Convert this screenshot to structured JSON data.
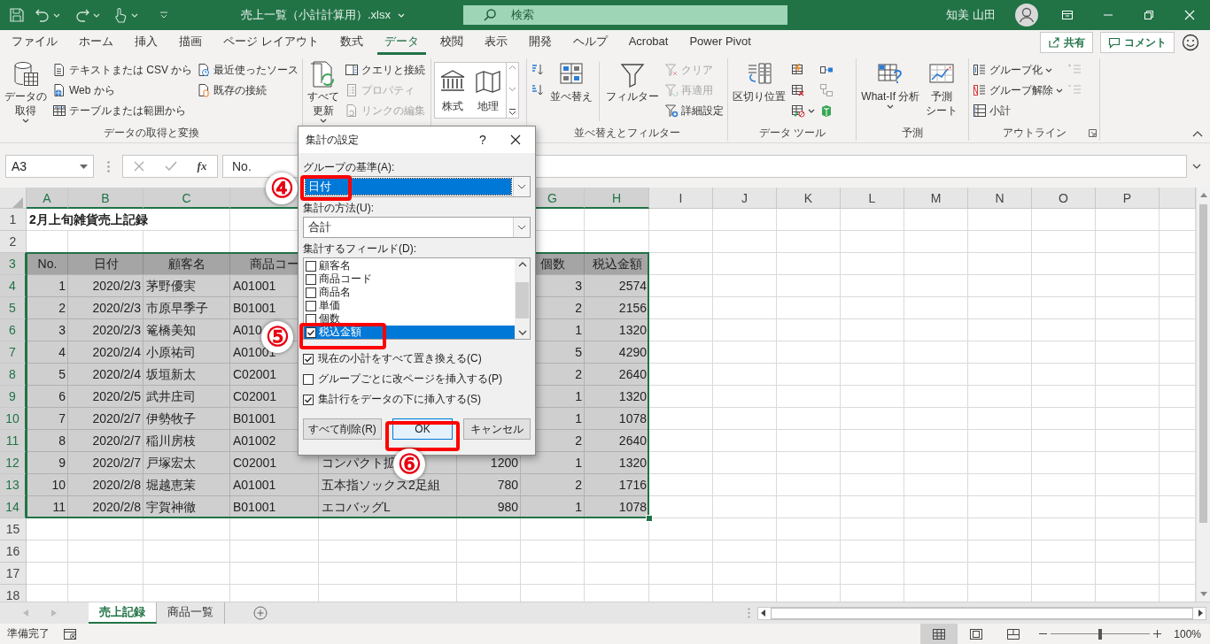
{
  "title_bar": {
    "file_name": "売上一覧（小計計算用）.xlsx",
    "search_placeholder": "検索",
    "user_name": "知美 山田"
  },
  "ribbon_tabs": [
    {
      "label": "ファイル",
      "selected": false
    },
    {
      "label": "ホーム",
      "selected": false
    },
    {
      "label": "挿入",
      "selected": false
    },
    {
      "label": "描画",
      "selected": false
    },
    {
      "label": "ページ レイアウト",
      "selected": false
    },
    {
      "label": "数式",
      "selected": false
    },
    {
      "label": "データ",
      "selected": true
    },
    {
      "label": "校閲",
      "selected": false
    },
    {
      "label": "表示",
      "selected": false
    },
    {
      "label": "開発",
      "selected": false
    },
    {
      "label": "ヘルプ",
      "selected": false
    },
    {
      "label": "Acrobat",
      "selected": false
    },
    {
      "label": "Power Pivot",
      "selected": false
    }
  ],
  "share_button": "共有",
  "comment_button": "コメント",
  "ribbon_groups": [
    {
      "label": "データの取得と変換",
      "launcher": false,
      "columns": [
        {
          "kind": "large",
          "label_lines": [
            "データの",
            "取得"
          ],
          "has_menu": true
        },
        {
          "kind": "stack",
          "items": [
            {
              "label": "テキストまたは CSV から",
              "disabled": false,
              "has_menu": false
            },
            {
              "label": "Web から",
              "disabled": false,
              "has_menu": false
            },
            {
              "label": "テーブルまたは範囲から",
              "disabled": false,
              "has_menu": false
            }
          ]
        },
        {
          "kind": "stack",
          "items": [
            {
              "label": "最近使ったソース",
              "disabled": false,
              "has_menu": false
            },
            {
              "label": "既存の接続",
              "disabled": false,
              "has_menu": false
            }
          ]
        }
      ]
    },
    {
      "columns": [
        {
          "kind": "large",
          "label_lines": [
            "すべて",
            "更新"
          ],
          "has_menu": true
        },
        {
          "kind": "stack",
          "items": [
            {
              "label": "クエリと接続",
              "disabled": false,
              "has_menu": false
            },
            {
              "label": "プロパティ",
              "disabled": true,
              "has_menu": false
            },
            {
              "label": "リンクの編集",
              "disabled": true,
              "has_menu": false
            }
          ]
        }
      ]
    },
    {
      "columns": [
        {
          "kind": "gallery",
          "items": [
            {
              "label": "株式"
            },
            {
              "label": "地理"
            }
          ]
        }
      ]
    },
    {
      "label": "並べ替えとフィルター",
      "launcher": false,
      "columns": [
        {
          "kind": "stack",
          "items": [
            {
              "disabled": false,
              "has_menu": false
            },
            {
              "disabled": false,
              "has_menu": false
            }
          ]
        },
        {
          "kind": "large",
          "label_lines": [
            "並べ替え"
          ],
          "has_menu": false
        },
        {
          "kind": "large",
          "label_lines": [
            "フィルター"
          ],
          "has_menu": false
        },
        {
          "kind": "stack",
          "items": [
            {
              "label": "クリア",
              "disabled": true,
              "has_menu": false
            },
            {
              "label": "再適用",
              "disabled": true,
              "has_menu": false
            },
            {
              "label": "詳細設定",
              "disabled": false,
              "has_menu": false
            }
          ]
        }
      ]
    },
    {
      "label": "データ ツール",
      "launcher": false,
      "columns": [
        {
          "kind": "large",
          "label_lines": [
            "区切り位置"
          ],
          "has_menu": false
        },
        {
          "kind": "stack",
          "items": [
            {
              "disabled": false,
              "has_menu": false
            },
            {
              "disabled": false,
              "has_menu": false
            },
            {
              "disabled": false,
              "has_menu": true
            }
          ]
        },
        {
          "kind": "stack",
          "items": [
            {
              "disabled": false,
              "has_menu": false
            },
            {
              "disabled": true,
              "has_menu": false
            },
            {
              "disabled": false,
              "has_menu": false
            }
          ]
        }
      ]
    },
    {
      "label": "予測",
      "launcher": false,
      "columns": [
        {
          "kind": "large",
          "label_lines": [
            "What-If 分析"
          ],
          "has_menu": true
        },
        {
          "kind": "large",
          "label_lines": [
            "予測",
            "シート"
          ],
          "has_menu": false
        }
      ]
    },
    {
      "label": "アウトライン",
      "launcher": true,
      "columns": [
        {
          "kind": "stack",
          "items": [
            {
              "label": "グループ化",
              "disabled": false,
              "has_menu": true
            },
            {
              "label": "グループ解除",
              "disabled": false,
              "has_menu": true
            },
            {
              "label": "小計",
              "disabled": false,
              "has_menu": false
            }
          ]
        },
        {
          "kind": "stack",
          "items": [
            {
              "disabled": true,
              "has_menu": false
            },
            {
              "disabled": true,
              "has_menu": false
            }
          ]
        }
      ]
    }
  ],
  "formula_bar": {
    "name_box": "A3",
    "function_button": "fx",
    "formula": "No."
  },
  "sheet": {
    "columns": [
      {
        "label": "A",
        "selected": true
      },
      {
        "label": "B",
        "selected": true
      },
      {
        "label": "C",
        "selected": true
      },
      {
        "selected": true
      },
      null,
      null,
      {
        "label": "G",
        "selected": true
      },
      {
        "label": "H",
        "selected": true
      },
      {
        "label": "I",
        "selected": false
      },
      {
        "label": "J",
        "selected": false
      },
      {
        "label": "K",
        "selected": false
      },
      {
        "label": "L",
        "selected": false
      },
      {
        "label": "M",
        "selected": false
      },
      {
        "label": "N",
        "selected": false
      },
      {
        "label": "O",
        "selected": false
      },
      {
        "label": "P",
        "selected": false
      }
    ],
    "rows": [
      {
        "number": "1",
        "kind": "title",
        "selected": false,
        "cells": [
          "2月上旬雑貨売上記録"
        ]
      },
      {
        "number": "2",
        "kind": "blank",
        "selected": false
      },
      {
        "number": "3",
        "kind": "header",
        "selected": true,
        "cells": [
          "No.",
          "日付",
          "顧客名",
          "商品コー",
          null,
          null,
          "個数",
          "税込金額"
        ]
      },
      {
        "number": "4",
        "kind": "data",
        "selected": true,
        "cells": [
          "1",
          "2020/2/3",
          "茅野優実",
          "A01001",
          null,
          null,
          "3",
          "2574"
        ]
      },
      {
        "number": "5",
        "kind": "data",
        "selected": true,
        "cells": [
          "2",
          "2020/2/3",
          "市原早季子",
          "B01001",
          null,
          null,
          "2",
          "2156"
        ]
      },
      {
        "number": "6",
        "kind": "data",
        "selected": true,
        "cells": [
          "3",
          "2020/2/3",
          "篭橋美知",
          "A010",
          null,
          null,
          "1",
          "1320"
        ]
      },
      {
        "number": "7",
        "kind": "data",
        "selected": true,
        "cells": [
          "4",
          "2020/2/4",
          "小原祐司",
          "A01001",
          null,
          null,
          "5",
          "4290"
        ]
      },
      {
        "number": "8",
        "kind": "data",
        "selected": true,
        "cells": [
          "5",
          "2020/2/4",
          "坂垣新太",
          "C02001",
          null,
          null,
          "2",
          "2640"
        ]
      },
      {
        "number": "9",
        "kind": "data",
        "selected": true,
        "cells": [
          "6",
          "2020/2/5",
          "武井庄司",
          "C02001",
          null,
          null,
          "1",
          "1320"
        ]
      },
      {
        "number": "10",
        "kind": "data",
        "selected": true,
        "cells": [
          "7",
          "2020/2/7",
          "伊勢牧子",
          "B01001",
          null,
          null,
          "1",
          "1078"
        ]
      },
      {
        "number": "11",
        "kind": "data",
        "selected": true,
        "cells": [
          "8",
          "2020/2/7",
          "稲川房枝",
          "A01002",
          null,
          null,
          "2",
          "2640"
        ]
      },
      {
        "number": "12",
        "kind": "data",
        "selected": true,
        "cells": [
          "9",
          "2020/2/7",
          "戸塚宏太",
          "C02001",
          "コンパクト拡",
          "1200",
          "1",
          "1320"
        ]
      },
      {
        "number": "13",
        "kind": "data",
        "selected": true,
        "cells": [
          "10",
          "2020/2/8",
          "堀越恵茉",
          "A01001",
          "五本指ソックス2足組",
          "780",
          "2",
          "1716"
        ]
      },
      {
        "number": "14",
        "kind": "data",
        "selected": true,
        "cells": [
          "11",
          "2020/2/8",
          "宇賀神徹",
          "B01001",
          "エコバッグL",
          "980",
          "1",
          "1078"
        ]
      },
      {
        "number": "15",
        "kind": "blank",
        "selected": false
      },
      {
        "number": "16",
        "kind": "blank",
        "selected": false
      },
      {
        "number": "17",
        "kind": "blank",
        "selected": false
      },
      {
        "number": "18",
        "kind": "blank",
        "selected": false
      }
    ]
  },
  "sheet_tabs": [
    {
      "label": "売上記録",
      "selected": true
    },
    {
      "label": "商品一覧",
      "selected": false
    }
  ],
  "status_bar": {
    "text": "準備完了",
    "views": [
      {
        "selected": true
      },
      {
        "selected": false
      },
      {
        "selected": false
      }
    ],
    "zoom": {
      "label": "100%",
      "level": 0.5
    }
  },
  "dialog": {
    "title": "集計の設定",
    "help_button": "?",
    "fields": [
      {
        "label": "グループの基準(A):",
        "value": "日付",
        "focused": true
      },
      {
        "label": "集計の方法(U):",
        "value": "合計",
        "focused": false
      }
    ],
    "list_label": "集計するフィールド(D):",
    "list_items": [
      {
        "label": "顧客名",
        "checked": false,
        "selected": false
      },
      {
        "label": "商品コード",
        "checked": false,
        "selected": false
      },
      {
        "label": "商品名",
        "checked": false,
        "selected": false
      },
      {
        "label": "単価",
        "checked": false,
        "selected": false
      },
      {
        "label": "個数",
        "checked": false,
        "selected": false
      },
      {
        "label": "税込金額",
        "checked": true,
        "selected": true
      }
    ],
    "options": [
      {
        "label": "現在の小計をすべて置き換える(C)",
        "checked": true
      },
      {
        "label": "グループごとに改ページを挿入する(P)",
        "checked": false
      },
      {
        "label": "集計行をデータの下に挿入する(S)",
        "checked": true
      }
    ],
    "buttons": [
      {
        "label": "すべて削除(R)",
        "default": false
      },
      {
        "label": "OK",
        "default": true
      },
      {
        "label": "キャンセル",
        "default": false
      }
    ]
  },
  "annotations": [
    {
      "text": "④"
    },
    {
      "text": "⑤"
    },
    {
      "text": "⑥"
    }
  ]
}
